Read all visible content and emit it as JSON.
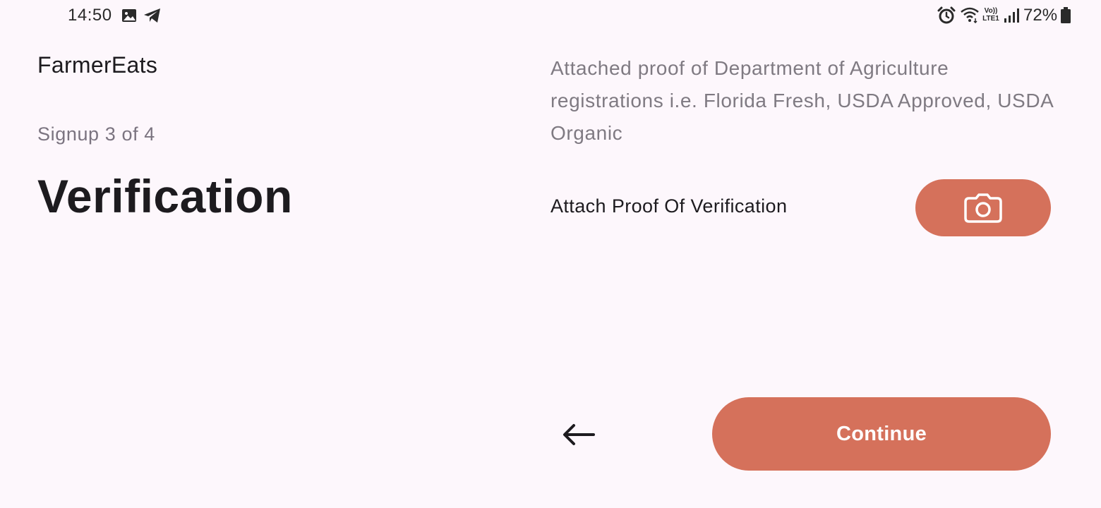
{
  "status_bar": {
    "time": "14:50",
    "battery_percent": "72%",
    "network_label": "Vo)) LTE1",
    "icons": [
      "image-icon",
      "telegram-icon",
      "alarm-icon",
      "wifi-icon",
      "volte-icon",
      "signal-icon",
      "battery-icon"
    ]
  },
  "header": {
    "app_name": "FarmerEats",
    "step": "Signup 3 of 4",
    "title": "Verification"
  },
  "verification": {
    "description": "Attached proof of Department of Agriculture registrations i.e. Florida Fresh, USDA Approved, USDA Organic",
    "attach_label": "Attach Proof Of Verification",
    "camera_icon": "camera-icon"
  },
  "footer": {
    "back_icon": "arrow-left-icon",
    "continue_label": "Continue"
  },
  "colors": {
    "accent": "#d5715b",
    "background": "#fdf7fc",
    "muted_text": "#7f7a82",
    "primary_text": "#1d1b1f"
  }
}
